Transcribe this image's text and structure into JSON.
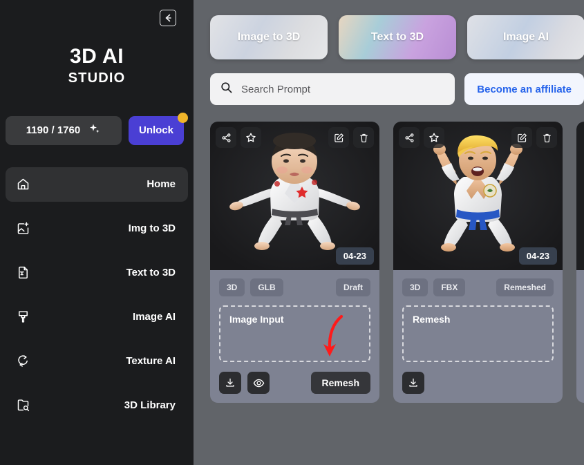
{
  "sidebar": {
    "collapse_icon": "arrow-left-icon",
    "brand": {
      "line1": "3D AI",
      "line2": "STUDIO"
    },
    "credits": {
      "value": "1190 / 1760",
      "icon": "sparkle-icon"
    },
    "unlock": {
      "label": "Unlock",
      "badge_color": "#f0b52a",
      "color": "#4a3fd4"
    },
    "items": [
      {
        "label": "Home",
        "icon": "home-icon",
        "active": true
      },
      {
        "label": "Img to 3D",
        "icon": "image-plus-icon",
        "active": false
      },
      {
        "label": "Text to 3D",
        "icon": "file-text-icon",
        "active": false
      },
      {
        "label": "Image AI",
        "icon": "brush-icon",
        "active": false
      },
      {
        "label": "Texture AI",
        "icon": "texture-cube-icon",
        "active": false
      },
      {
        "label": "3D Library",
        "icon": "folder-search-icon",
        "active": false
      }
    ]
  },
  "header": {
    "tabs": [
      {
        "label": "Image to 3D"
      },
      {
        "label": "Text to 3D"
      },
      {
        "label": "Image AI"
      }
    ],
    "search": {
      "placeholder": "Search Prompt",
      "value": "",
      "icon": "search-icon"
    },
    "affiliate": {
      "label": "Become an affiliate",
      "color": "#2563eb"
    }
  },
  "cards": [
    {
      "media_icons_left": [
        "share-icon",
        "star-icon"
      ],
      "media_icons_right": [
        "edit-icon",
        "trash-icon"
      ],
      "date": "04-23",
      "badges": [
        "3D",
        "GLB"
      ],
      "status": "Draft",
      "dropzone_label": "Image Input",
      "actions": [
        "download-icon",
        "eye-icon"
      ],
      "primary_action": "Remesh",
      "has_annotation_arrow": true,
      "annotation_color": "#ff1a1a"
    },
    {
      "media_icons_left": [
        "share-icon",
        "star-icon"
      ],
      "media_icons_right": [
        "edit-icon",
        "trash-icon"
      ],
      "date": "04-23",
      "badges": [
        "3D",
        "FBX"
      ],
      "status": "Remeshed",
      "dropzone_label": "Remesh",
      "actions": [
        "download-icon"
      ],
      "primary_action": "",
      "has_annotation_arrow": false,
      "annotation_color": ""
    }
  ]
}
